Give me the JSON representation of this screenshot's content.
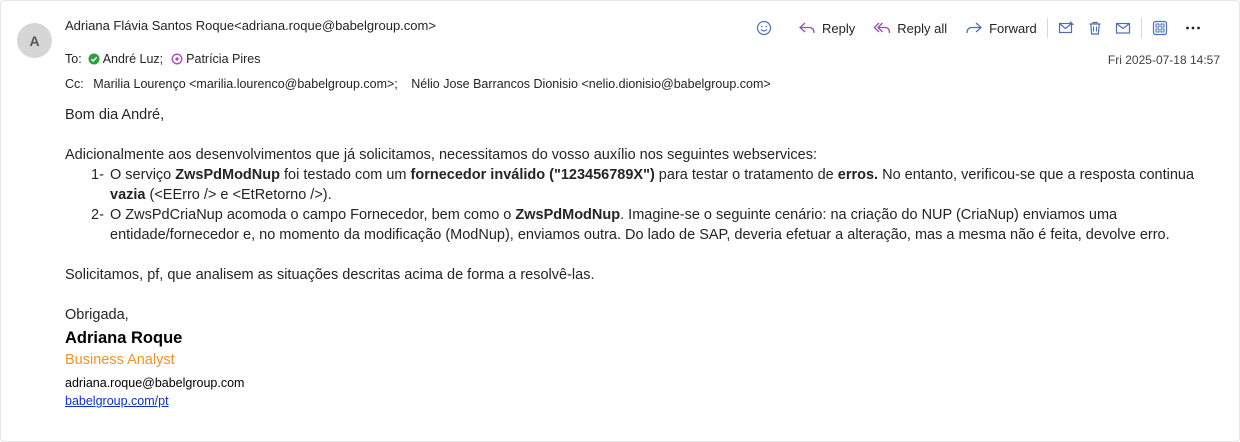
{
  "sender": {
    "avatar_initial": "A",
    "display": "Adriana Flávia Santos Roque<adriana.roque@babelgroup.com>"
  },
  "toolbar": {
    "reply_label": "Reply",
    "reply_all_label": "Reply all",
    "forward_label": "Forward",
    "accent_color": "#4a6fb5"
  },
  "to": {
    "label": "To:",
    "recipients": [
      {
        "name": "André Luz;",
        "status_icon": "available-check-icon",
        "status_color": "#2e9e3e"
      },
      {
        "name": "Patrícia Pires",
        "status_icon": "away-circle-icon",
        "status_color": "#b146c2"
      }
    ]
  },
  "cc": {
    "label": "Cc:",
    "recipients": [
      "Marilia Lourenço <marilia.lourenco@babelgroup.com>;",
      "Nélio Jose Barrancos Dionisio <nelio.dionisio@babelgroup.com>"
    ]
  },
  "date": "Fri 2025-07-18 14:57",
  "body": {
    "greeting": "Bom dia André,",
    "intro": "Adicionalmente aos desenvolvimentos que já solicitamos, necessitamos do vosso auxílio nos seguintes webservices:",
    "item1": {
      "num": "1-",
      "t1": "O serviço ",
      "b1": "ZwsPdModNup",
      "t2": " foi testado com um ",
      "b2": "fornecedor inválido (\"123456789X\")",
      "t3": " para testar o tratamento de ",
      "b3": "erros.",
      "t4": " No entanto, verificou-se que a resposta continua ",
      "b4": "vazia",
      "t5": " (<EErro /> e <EtRetorno />)."
    },
    "item2": {
      "num": "2-",
      "t1": "O ZwsPdCriaNup acomoda o campo Fornecedor, bem como o ",
      "b1": "ZwsPdModNup",
      "t2": ". Imagine-se o seguinte cenário: na criação do NUP (CriaNup) enviamos uma entidade/fornecedor e, no momento da modificação (ModNup), enviamos outra. Do lado de SAP, deveria efetuar a alteração, mas a mesma não é feita, devolve erro."
    },
    "request": "Solicitamos, pf, que analisem as situações descritas acima de forma a resolvê-las.",
    "closing": "Obrigada,"
  },
  "signature": {
    "name": "Adriana Roque",
    "role": "Business Analyst",
    "role_color": "#f0932b",
    "email": "adriana.roque@babelgroup.com",
    "link": "babelgroup.com/pt"
  }
}
